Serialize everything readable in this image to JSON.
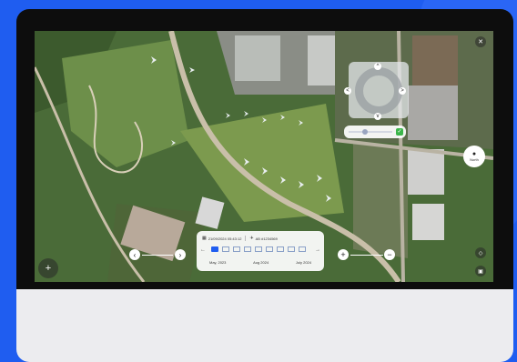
{
  "timeline": {
    "date_time": "21/09/2024 05:43:12",
    "flight_id": "AB #1234569",
    "months": [
      "May, 2023",
      "Aug 2024",
      "July 2024"
    ]
  },
  "location_button": {
    "label": "North"
  },
  "stream": {
    "pos": 0.35
  },
  "colors": {
    "accent": "#1f5df0",
    "confirm": "#3bb54a"
  }
}
